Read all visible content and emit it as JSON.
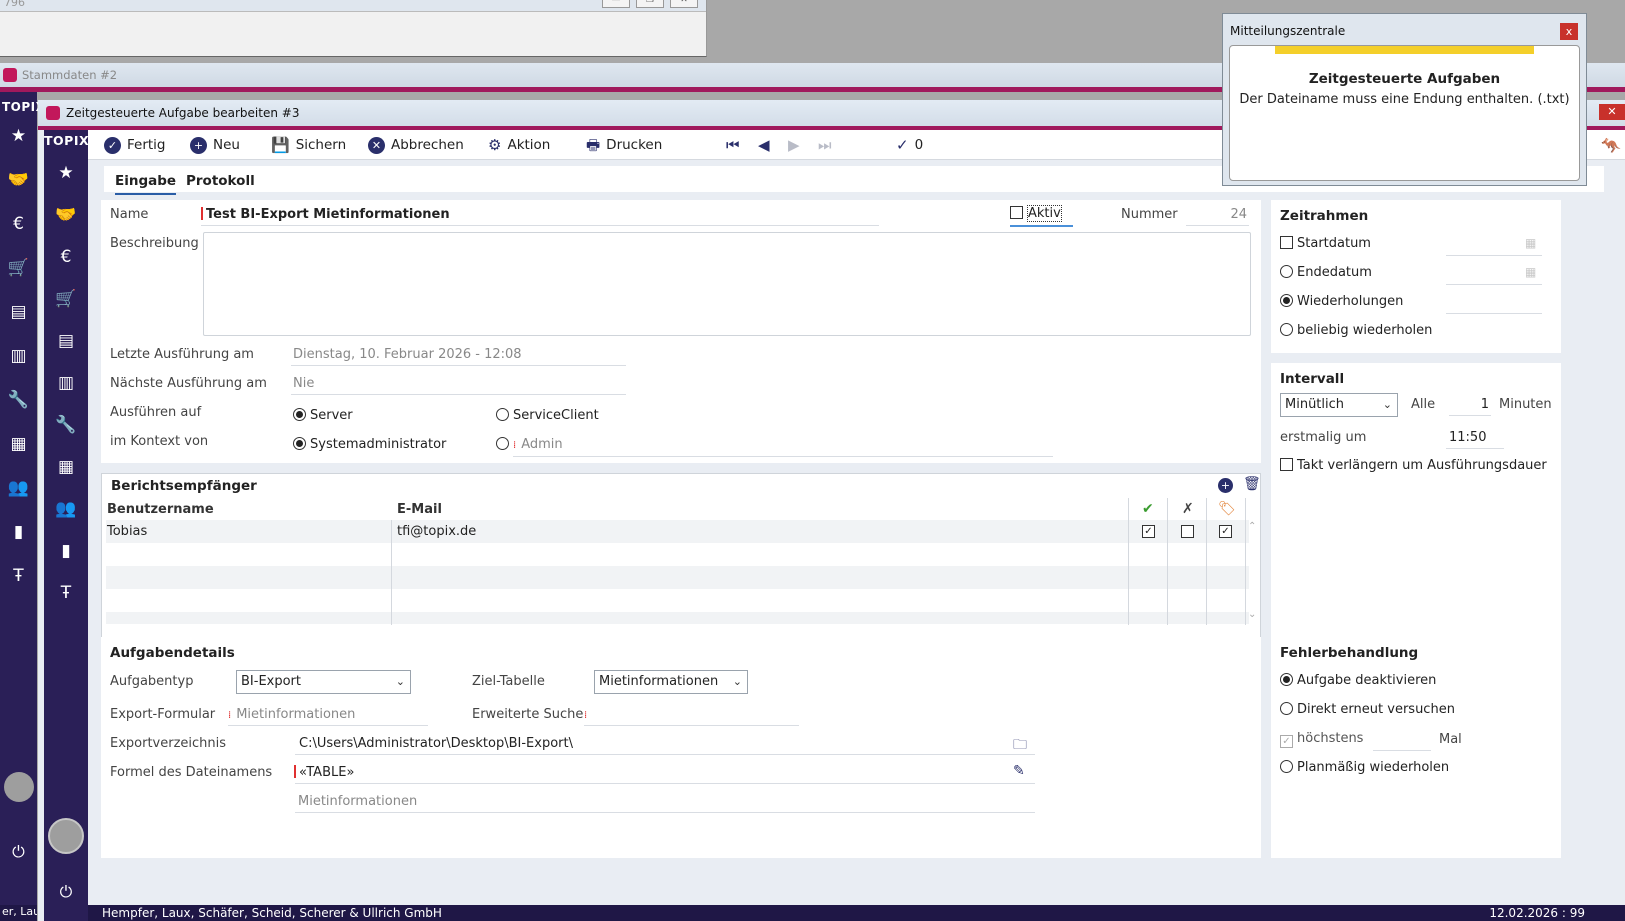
{
  "background_window": {
    "title": "796",
    "buttons": [
      "—",
      "❐",
      "✕"
    ]
  },
  "stammdaten_window": {
    "title": "Stammdaten #2"
  },
  "outer_sidebar": {
    "brand": "TOPIX",
    "footer_text": "er, Lau"
  },
  "window": {
    "title": "Zeitgesteuerte Aufgabe bearbeiten #3",
    "close_label": "✕"
  },
  "sidebar": {
    "brand": "TOPIX"
  },
  "toolbar": {
    "fertig": "Fertig",
    "neu": "Neu",
    "sichern": "Sichern",
    "abbrechen": "Abbrechen",
    "aktion": "Aktion",
    "drucken": "Drucken",
    "count": "0"
  },
  "tabs": {
    "eingabe": "Eingabe",
    "protokoll": "Protokoll"
  },
  "form": {
    "name_label": "Name",
    "name_value": "Test BI-Export Mietinformationen",
    "aktiv_label": "Aktiv",
    "aktiv_checked": false,
    "nummer_label": "Nummer",
    "nummer_value": "24",
    "beschreibung_label": "Beschreibung",
    "beschreibung_value": "",
    "letzte_label": "Letzte Ausführung am",
    "letzte_value": "Dienstag, 10. Februar 2026 - 12:08",
    "naechste_label": "Nächste Ausführung am",
    "naechste_value": "Nie",
    "ausfuehren_label": "Ausführen auf",
    "ausfuehren_options": {
      "server": "Server",
      "serviceclient": "ServiceClient"
    },
    "ausfuehren_selected": "Server",
    "kontext_label": "im Kontext von",
    "kontext_options": {
      "system": "Systemadministrator",
      "admin": "Admin"
    },
    "kontext_selected": "Systemadministrator"
  },
  "zeitrahmen": {
    "title": "Zeitrahmen",
    "startdatum": "Startdatum",
    "endedatum": "Endedatum",
    "wiederholungen": "Wiederholungen",
    "beliebig": "beliebig wiederholen",
    "selected": "Wiederholungen"
  },
  "intervall": {
    "title": "Intervall",
    "select_value": "Minütlich",
    "alle_label": "Alle",
    "alle_value": "1",
    "unit": "Minuten",
    "erstmalig_label": "erstmalig um",
    "erstmalig_value": "11:50",
    "takt_label": "Takt verlängern um Ausführungsdauer",
    "takt_checked": false
  },
  "recipients": {
    "title": "Berichtsempfänger",
    "columns": {
      "username": "Benutzername",
      "email": "E-Mail"
    },
    "icon_columns": [
      "check-green-icon",
      "cross-icon",
      "tag-icon"
    ],
    "rows": [
      {
        "username": "Tobias",
        "email": "tfi@topix.de",
        "col1": true,
        "col2": false,
        "col3": true
      }
    ]
  },
  "details": {
    "title": "Aufgabendetails",
    "aufgabentyp_label": "Aufgabentyp",
    "aufgabentyp_value": "BI-Export",
    "ziel_label": "Ziel-Tabelle",
    "ziel_value": "Mietinformationen",
    "export_formular_label": "Export-Formular",
    "export_formular_placeholder": "Mietinformationen",
    "erweiterte_suche_label": "Erweiterte Suche",
    "exportverzeichnis_label": "Exportverzeichnis",
    "exportverzeichnis_value": "C:\\Users\\Administrator\\Desktop\\BI-Export\\",
    "formel_label": "Formel des Dateinamens",
    "formel_value": "«TABLE»",
    "formel_preview": "Mietinformationen"
  },
  "fehler": {
    "title": "Fehlerbehandlung",
    "deaktivieren": "Aufgabe deaktivieren",
    "direkt": "Direkt erneut versuchen",
    "hoechstens": "höchstens",
    "mal": "Mal",
    "planmaessig": "Planmäßig wiederholen",
    "selected": "Aufgabe deaktivieren"
  },
  "status": {
    "company": "Hempfer, Laux, Schäfer, Scheid, Scherer & Ullrich GmbH",
    "right": "12.02.2026 : 99"
  },
  "notification": {
    "window_title": "Mitteilungszentrale",
    "heading": "Zeitgesteuerte Aufgaben",
    "message": "Der Dateiname muss eine Endung enthalten. (.txt)",
    "close_label": "x",
    "accent_color": "#f4cf2a"
  },
  "colors": {
    "brand": "#2a1f57",
    "accent": "#a0195c",
    "status_bar": "#1f1746"
  }
}
